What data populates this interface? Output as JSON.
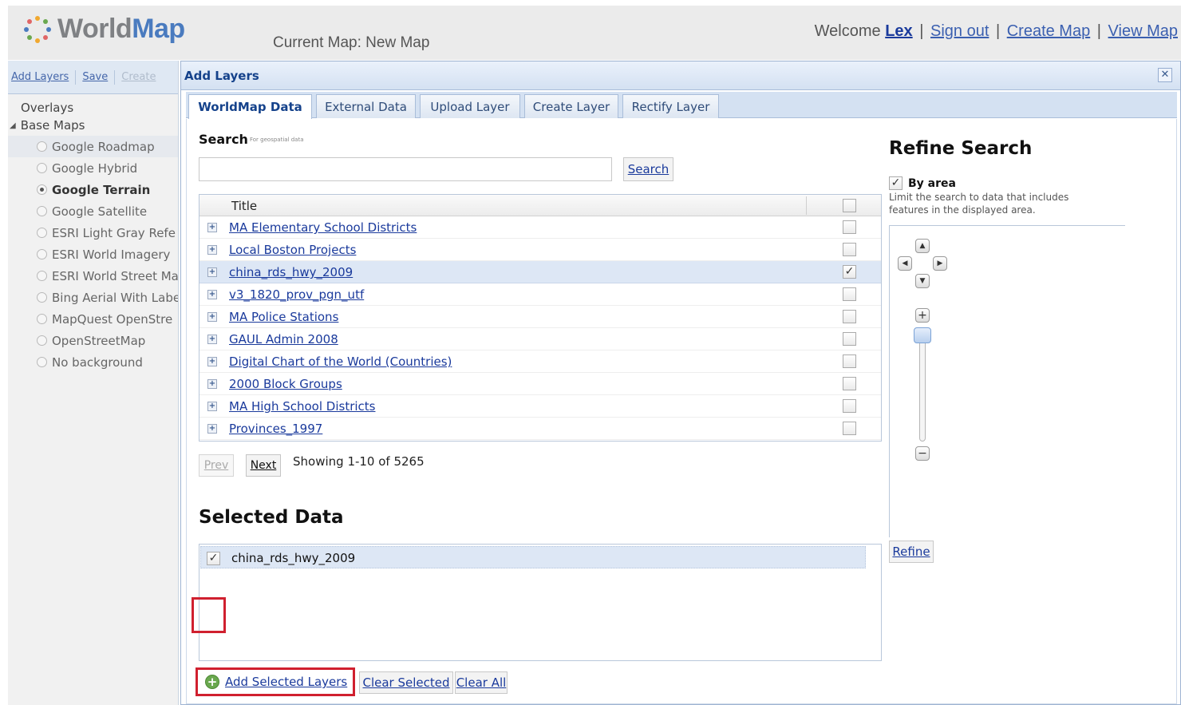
{
  "header": {
    "logo_part1": "World",
    "logo_part2": "Map",
    "current_map": "Current Map: New Map",
    "welcome": "Welcome",
    "username": "Lex",
    "links": [
      "Sign out",
      "Create Map",
      "View Map"
    ],
    "separator": "|"
  },
  "left_panel": {
    "toolbar": [
      "Add Layers",
      "Save",
      "Create"
    ],
    "overlays_label": "Overlays",
    "base_maps_label": "Base Maps",
    "base_maps": [
      "Google Roadmap",
      "Google Hybrid",
      "Google Terrain",
      "Google Satellite",
      "ESRI Light Gray Refe",
      "ESRI World Imagery",
      "ESRI World Street Ma",
      "Bing Aerial With Labe",
      "MapQuest OpenStre",
      "OpenStreetMap",
      "No background"
    ],
    "selected_base_map": "Google Terrain"
  },
  "dialog": {
    "title": "Add Layers",
    "close_icon": "close-icon",
    "tabs": [
      "WorldMap Data",
      "External Data",
      "Upload Layer",
      "Create Layer",
      "Rectify Layer"
    ],
    "active_tab": "WorldMap Data",
    "search": {
      "label": "Search",
      "sublabel": "For geospatial data",
      "value": "",
      "button": "Search"
    },
    "grid": {
      "column_title": "Title",
      "rows": [
        {
          "title": "MA Elementary School Districts",
          "checked": false
        },
        {
          "title": "Local Boston Projects",
          "checked": false
        },
        {
          "title": "china_rds_hwy_2009",
          "checked": true
        },
        {
          "title": "v3_1820_prov_pgn_utf",
          "checked": false
        },
        {
          "title": "MA Police Stations",
          "checked": false
        },
        {
          "title": "GAUL Admin 2008",
          "checked": false
        },
        {
          "title": "Digital Chart of the World (Countries)",
          "checked": false
        },
        {
          "title": "2000 Block Groups",
          "checked": false
        },
        {
          "title": "MA High School Districts",
          "checked": false
        },
        {
          "title": "Provinces_1997",
          "checked": false
        }
      ]
    },
    "pager": {
      "prev": "Prev",
      "next": "Next",
      "showing": "Showing 1-10 of 5265"
    },
    "selected": {
      "heading": "Selected Data",
      "items": [
        "china_rds_hwy_2009"
      ]
    },
    "actions": {
      "add_selected": "Add Selected Layers",
      "clear_selected": "Clear Selected",
      "clear_all": "Clear All"
    },
    "refine": {
      "title": "Refine Search",
      "by_area_label": "By area",
      "by_area_checked": true,
      "description": "Limit the search to data that includes features in the displayed area.",
      "button": "Refine"
    }
  },
  "colors": {
    "link": "#1a3a9c",
    "highlight_border": "#d0202f",
    "selected_row": "#dde7f5",
    "logo_gray": "#7f8184",
    "logo_blue": "#4a7bbf"
  }
}
